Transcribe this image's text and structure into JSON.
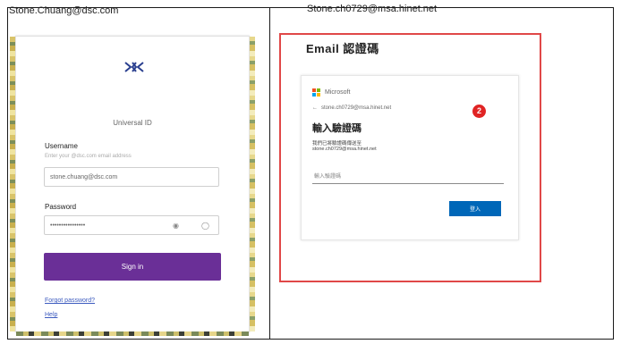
{
  "captions": {
    "left": "Stone.Chuang@dsc.com",
    "right": "Stone.ch0729@msa.hinet.net"
  },
  "login": {
    "logo": "dsc-logo-icon",
    "product_name": "Universal ID",
    "username_label": "Username",
    "username_hint": "Enter your @dsc.com email address",
    "username_value": "stone.chuang@dsc.com",
    "password_label": "Password",
    "password_value": "••••••••••••••••",
    "show_password_icon": "eye-icon",
    "clear_icon": "eye-off-icon",
    "signin_label": "Sign in",
    "forgot_label": "Forgot password?",
    "help_label": "Help",
    "accent_color": "#6a2f97"
  },
  "verify": {
    "title": "Email 認證碼",
    "brand": "Microsoft",
    "back_icon": "back-arrow-icon",
    "account": "stone.ch0729@msa.hinet.net",
    "heading": "輸入驗證碼",
    "desc_line1": "我們已將驗證碼傳送至",
    "desc_line2": "stone.ch0729@msa.hinet.net",
    "code_placeholder": "輸入驗證碼",
    "submit_label": "登入",
    "step_badge": "2",
    "border_color": "#e04848",
    "button_color": "#0067b8"
  }
}
